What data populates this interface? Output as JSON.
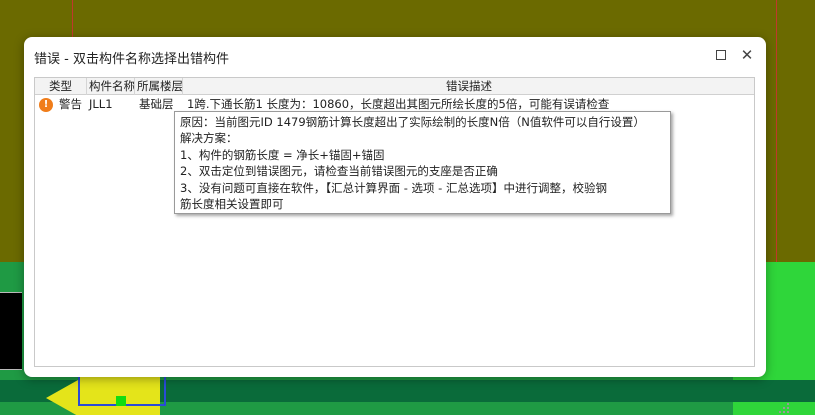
{
  "dialog": {
    "title": "错误 - 双击构件名称选择出错构件",
    "maximize_icon": "maximize-icon",
    "close_icon": "close-icon",
    "close_glyph": "✕"
  },
  "table": {
    "columns": [
      "类型",
      "构件名称",
      "所属楼层",
      "错误描述"
    ],
    "rows": [
      {
        "icon": "warning-icon",
        "icon_glyph": "!",
        "type": "警告",
        "name": "JLL1",
        "floor": "基础层",
        "description": "1跨.下通长筋1 长度为：10860，长度超出其图元所绘长度的5倍，可能有误请检查"
      }
    ]
  },
  "tooltip": {
    "lines": [
      "原因：当前图元ID 1479钢筋计算长度超出了实际绘制的长度N倍（N值软件可以自行设置）",
      "解决方案：",
      "1、构件的钢筋长度 = 净长+锚固+锚固",
      "2、双击定位到错误图元，请检查当前错误图元的支座是否正确",
      "3、没有问题可直接在软件，【汇总计算界面 - 选项 - 汇总选项】中进行调整，校验钢",
      "筋长度相关设置即可"
    ]
  },
  "colors": {
    "warning": "#f07d1a",
    "background": "#6b6a00",
    "green": "#1f9a44"
  }
}
